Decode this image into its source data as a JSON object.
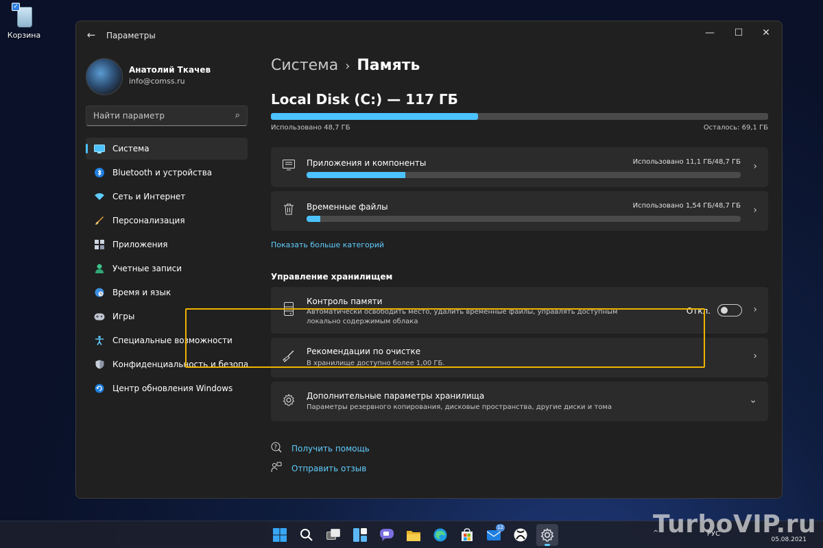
{
  "desktop": {
    "recycle_bin_label": "Корзина"
  },
  "window": {
    "app_title": "Параметры",
    "back_icon": "arrow-left-icon",
    "controls": [
      "minimize-icon",
      "maximize-icon",
      "close-icon"
    ]
  },
  "profile": {
    "name": "Анатолий Ткачев",
    "email": "info@comss.ru"
  },
  "search": {
    "placeholder": "Найти параметр",
    "value": ""
  },
  "sidebar": {
    "items": [
      {
        "label": "Система",
        "icon": "monitor-icon",
        "active": true
      },
      {
        "label": "Bluetooth и устройства",
        "icon": "bluetooth-icon",
        "active": false
      },
      {
        "label": "Сеть и Интернет",
        "icon": "wifi-icon",
        "active": false
      },
      {
        "label": "Персонализация",
        "icon": "brush-icon",
        "active": false
      },
      {
        "label": "Приложения",
        "icon": "apps-icon",
        "active": false
      },
      {
        "label": "Учетные записи",
        "icon": "person-icon",
        "active": false
      },
      {
        "label": "Время и язык",
        "icon": "globe-clock-icon",
        "active": false
      },
      {
        "label": "Игры",
        "icon": "gamepad-icon",
        "active": false
      },
      {
        "label": "Специальные возможности",
        "icon": "accessibility-icon",
        "active": false
      },
      {
        "label": "Конфиденциальность и безопасность",
        "icon": "shield-icon",
        "active": false
      },
      {
        "label": "Центр обновления Windows",
        "icon": "update-icon",
        "active": false
      }
    ]
  },
  "breadcrumb": {
    "parent": "Система",
    "separator": "›",
    "current": "Память"
  },
  "disk": {
    "title": "Local Disk (C:) — 117 ГБ",
    "used_label": "Использовано 48,7 ГБ",
    "free_label": "Осталось: 69,1 ГБ",
    "used_fraction": 0.416
  },
  "categories": [
    {
      "title": "Приложения и компоненты",
      "usage": "Использовано 11,1 ГБ/48,7 ГБ",
      "fraction": 0.228,
      "icon": "apps-list-icon"
    },
    {
      "title": "Временные файлы",
      "usage": "Использовано 1,54 ГБ/48,7 ГБ",
      "fraction": 0.032,
      "icon": "trash-icon"
    }
  ],
  "show_more": "Показать больше категорий",
  "management": {
    "section_title": "Управление хранилищем",
    "storage_sense": {
      "title": "Контроль памяти",
      "description": "Автоматически освободить место, удалить временные файлы, управлять доступным локально содержимым облака",
      "toggle_label": "Откл.",
      "toggle_on": false
    },
    "cleanup": {
      "title": "Рекомендации по очистке",
      "description": "В хранилище доступно более 1,00 ГБ."
    },
    "advanced": {
      "title": "Дополнительные параметры хранилища",
      "description": "Параметры резервного копирования, дисковые пространства, другие диски и тома"
    }
  },
  "help": {
    "get_help": "Получить помощь",
    "feedback": "Отправить отзыв"
  },
  "taskbar": {
    "icons": [
      "windows-start-icon",
      "search-icon",
      "task-view-icon",
      "widgets-icon",
      "chat-icon",
      "file-explorer-icon",
      "edge-icon",
      "store-icon",
      "mail-icon",
      "xbox-icon",
      "settings-icon"
    ],
    "mail_badge": "12",
    "language": "РУС",
    "date": "05.08.2021"
  },
  "watermark": "TurboVIP.ru",
  "colors": {
    "accent": "#4cc2ff",
    "link": "#60cdff",
    "highlight": "#f0b400",
    "window_bg": "#202020",
    "card_bg": "#2b2b2b"
  }
}
